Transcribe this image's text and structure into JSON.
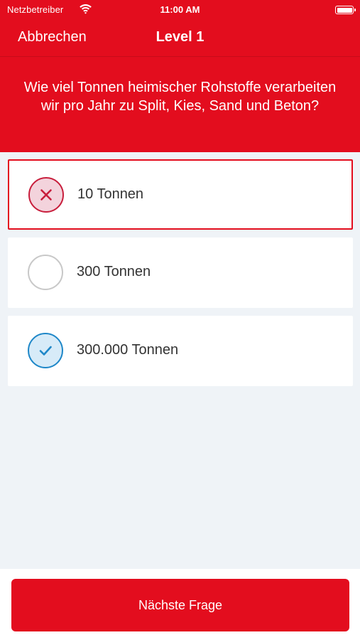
{
  "status_bar": {
    "carrier": "Netzbetreiber",
    "time": "11:00 AM",
    "wifi_icon": "wifi-icon",
    "battery_icon": "battery-icon"
  },
  "nav": {
    "cancel_label": "Abbrechen",
    "title": "Level 1"
  },
  "question": {
    "text": "Wie viel Tonnen heimischer Rohstoffe verarbeiten wir pro Jahr zu Split, Kies, Sand und Beton?"
  },
  "answers": [
    {
      "label": "10 Tonnen",
      "state": "wrong",
      "icon": "x-icon"
    },
    {
      "label": "300 Tonnen",
      "state": "neutral",
      "icon": "empty-circle-icon"
    },
    {
      "label": "300.000 Tonnen",
      "state": "correct",
      "icon": "check-icon"
    }
  ],
  "footer": {
    "next_label": "Nächste Frage"
  },
  "colors": {
    "brand_red": "#e30d1e",
    "background": "#eff3f7",
    "wrong": "#c81e3c",
    "correct": "#1e87c8"
  }
}
